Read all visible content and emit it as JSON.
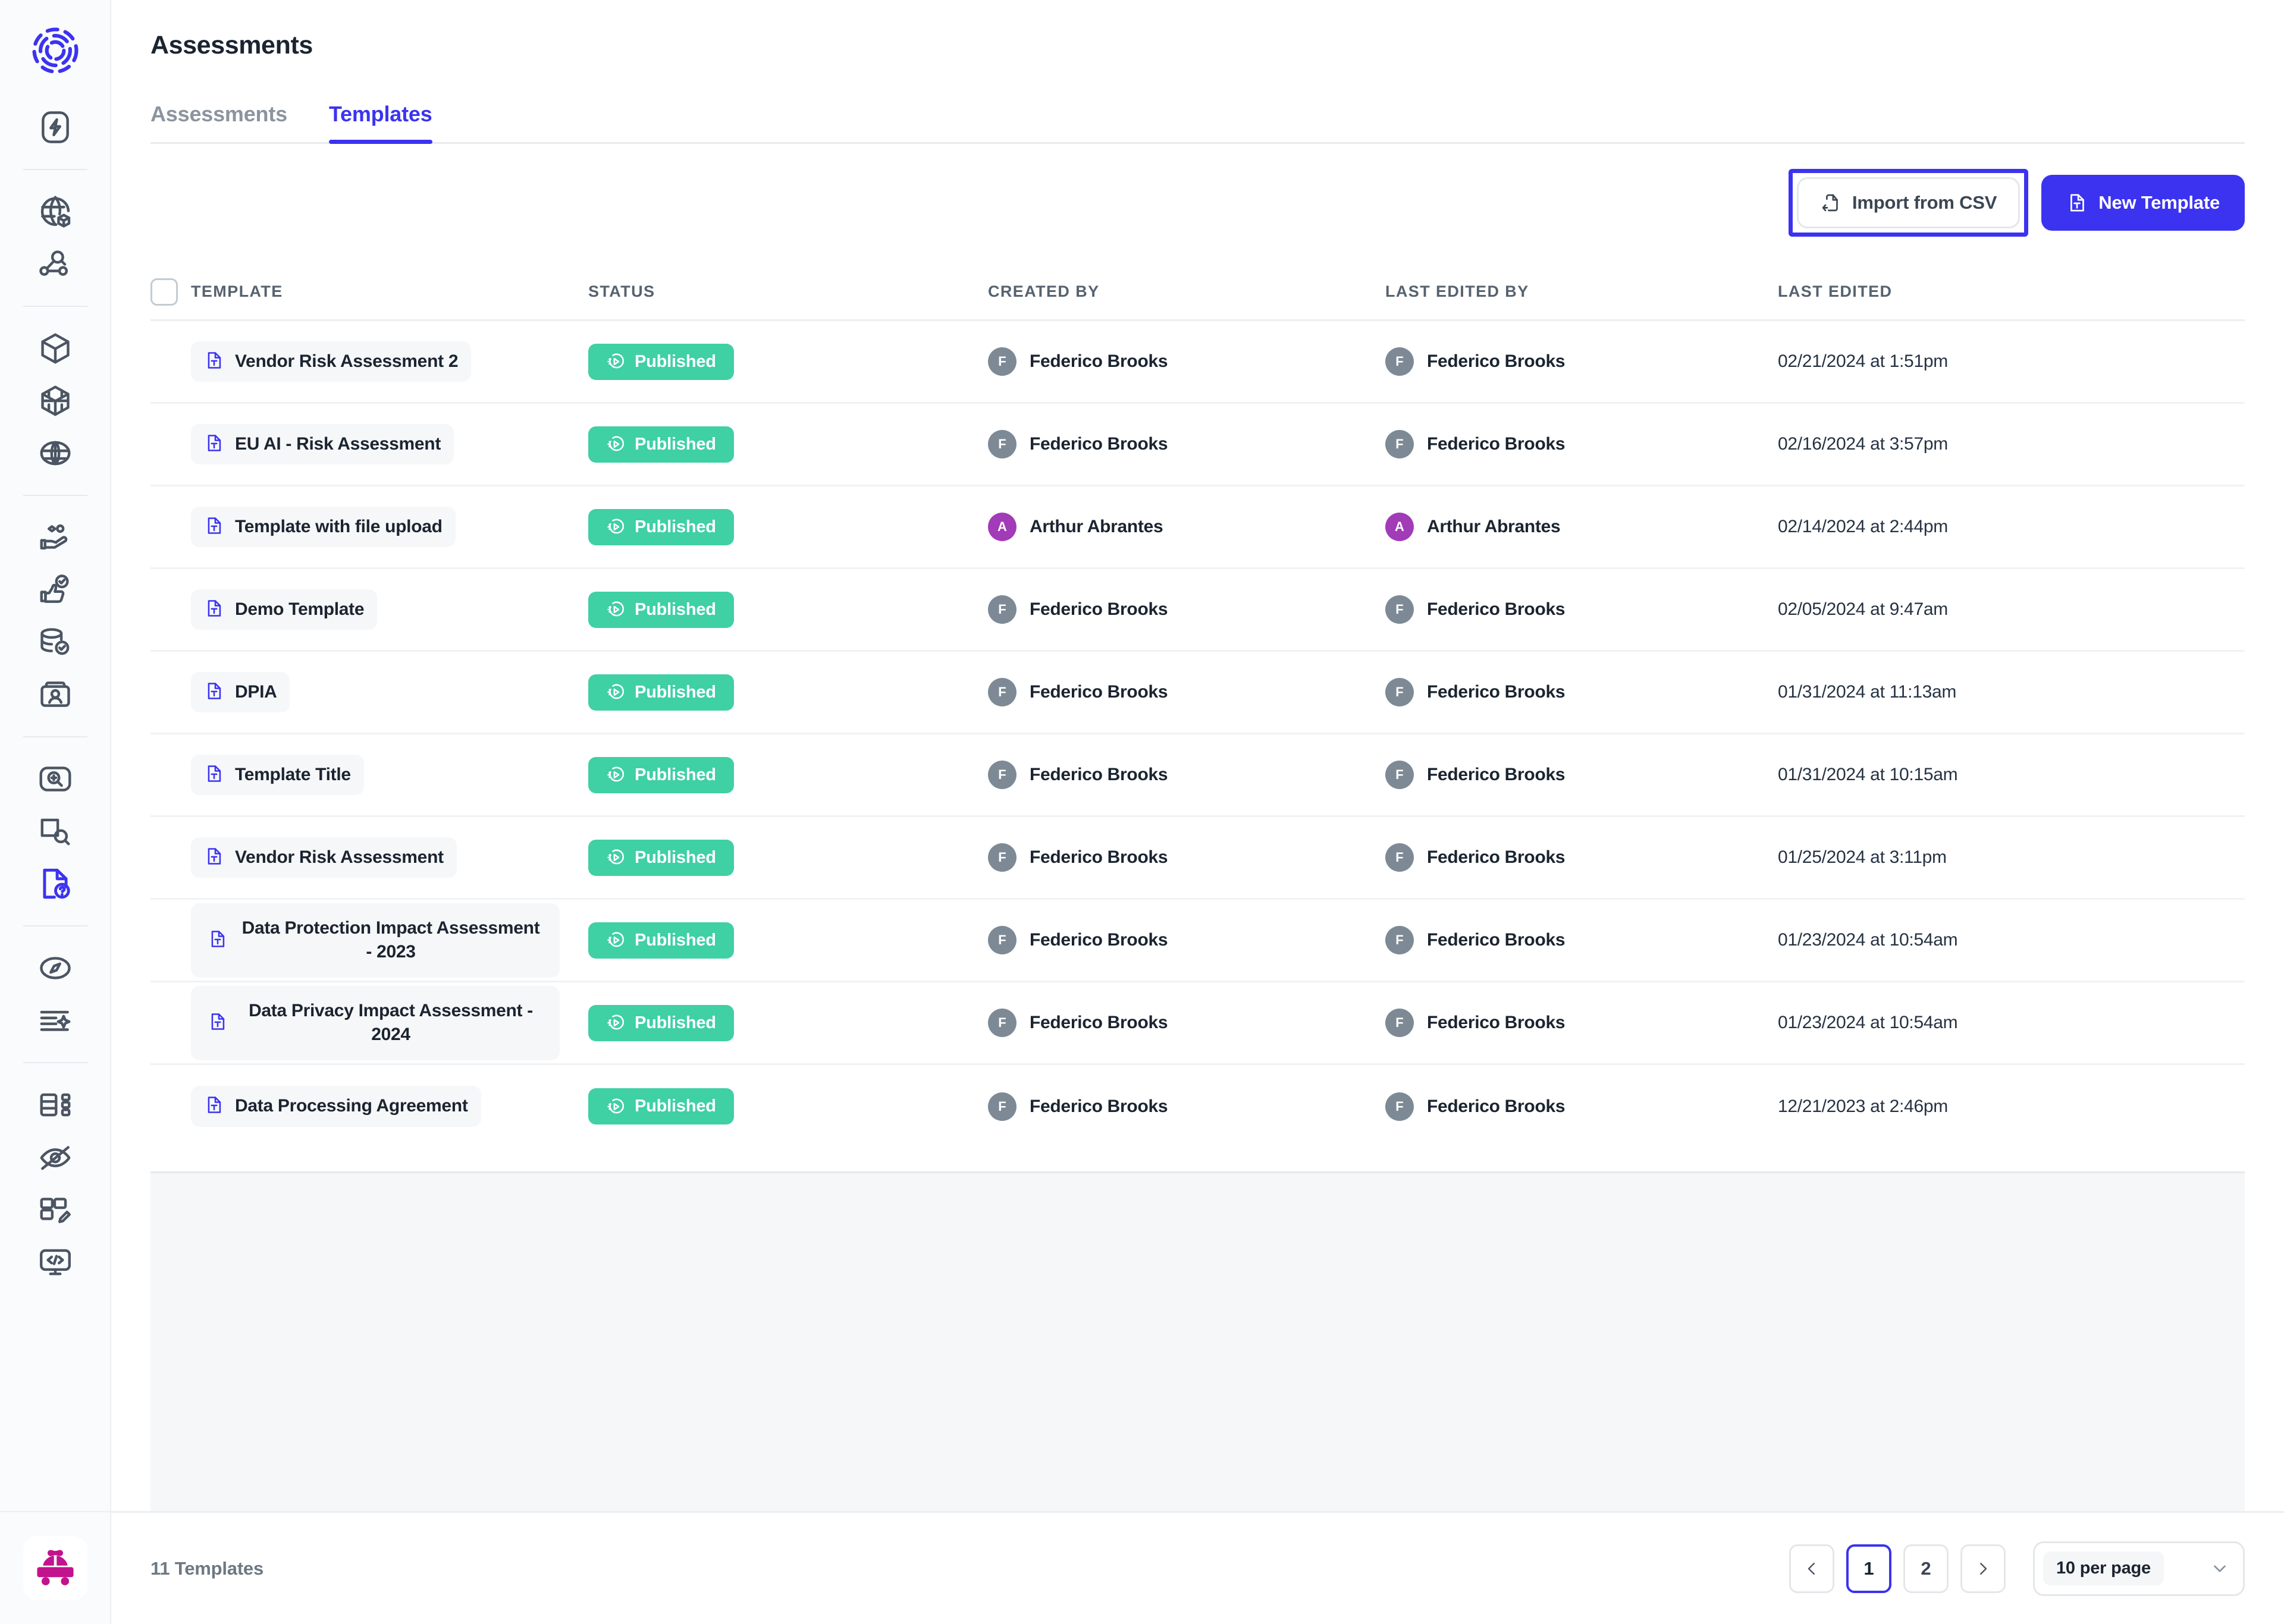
{
  "app": {
    "logo_icon": "fingerprint-circle-logo",
    "brand_icon": "pink-car-icon"
  },
  "sidebar": {
    "items": [
      {
        "icon": "lightning-bolt-icon",
        "name": "automation"
      },
      {
        "icon": "globe-box-icon",
        "name": "data-inventory"
      },
      {
        "icon": "network-search-icon",
        "name": "data-discovery"
      },
      {
        "icon": "cube-icon",
        "name": "assets"
      },
      {
        "icon": "cube-grid-icon",
        "name": "systems"
      },
      {
        "icon": "globe-sphere-icon",
        "name": "regions"
      },
      {
        "icon": "hand-coins-icon",
        "name": "vendors"
      },
      {
        "icon": "thumbs-up-check-icon",
        "name": "consent"
      },
      {
        "icon": "database-check-icon",
        "name": "data-governance"
      },
      {
        "icon": "id-card-icon",
        "name": "subject-requests"
      },
      {
        "icon": "search-zoom-icon",
        "name": "scans"
      },
      {
        "icon": "page-search-icon",
        "name": "reports"
      },
      {
        "icon": "document-question-icon",
        "name": "assessments"
      },
      {
        "icon": "compass-icon",
        "name": "navigator"
      },
      {
        "icon": "list-sparkle-icon",
        "name": "ai-insights"
      },
      {
        "icon": "table-tree-icon",
        "name": "schema"
      },
      {
        "icon": "eye-off-icon",
        "name": "privacy"
      },
      {
        "icon": "layout-edit-icon",
        "name": "customize"
      },
      {
        "icon": "code-screen-icon",
        "name": "developers"
      }
    ]
  },
  "header": {
    "title": "Assessments"
  },
  "tabs": [
    {
      "label": "Assessments",
      "active": false
    },
    {
      "label": "Templates",
      "active": true
    }
  ],
  "toolbar": {
    "import_label": "Import from CSV",
    "import_icon": "csv-import-icon",
    "new_template_label": "New Template",
    "new_template_icon": "document-text-icon",
    "import_focused": true
  },
  "table": {
    "columns": [
      "TEMPLATE",
      "STATUS",
      "CREATED BY",
      "LAST EDITED BY",
      "LAST EDITED"
    ],
    "select_all_checkbox": false,
    "rows": [
      {
        "template": "Vendor Risk Assessment 2",
        "status": "Published",
        "created_by": {
          "name": "Federico Brooks",
          "initial": "F",
          "color": "#7d8a96"
        },
        "last_edited_by": {
          "name": "Federico Brooks",
          "initial": "F",
          "color": "#7d8a96"
        },
        "last_edited": "02/21/2024 at 1:51pm"
      },
      {
        "template": "EU AI - Risk Assessment",
        "status": "Published",
        "created_by": {
          "name": "Federico Brooks",
          "initial": "F",
          "color": "#7d8a96"
        },
        "last_edited_by": {
          "name": "Federico Brooks",
          "initial": "F",
          "color": "#7d8a96"
        },
        "last_edited": "02/16/2024 at 3:57pm"
      },
      {
        "template": "Template with file upload",
        "status": "Published",
        "created_by": {
          "name": "Arthur Abrantes",
          "initial": "A",
          "color": "#a23bb8"
        },
        "last_edited_by": {
          "name": "Arthur Abrantes",
          "initial": "A",
          "color": "#a23bb8"
        },
        "last_edited": "02/14/2024 at 2:44pm"
      },
      {
        "template": "Demo Template",
        "status": "Published",
        "created_by": {
          "name": "Federico Brooks",
          "initial": "F",
          "color": "#7d8a96"
        },
        "last_edited_by": {
          "name": "Federico Brooks",
          "initial": "F",
          "color": "#7d8a96"
        },
        "last_edited": "02/05/2024 at 9:47am"
      },
      {
        "template": "DPIA",
        "status": "Published",
        "created_by": {
          "name": "Federico Brooks",
          "initial": "F",
          "color": "#7d8a96"
        },
        "last_edited_by": {
          "name": "Federico Brooks",
          "initial": "F",
          "color": "#7d8a96"
        },
        "last_edited": "01/31/2024 at 11:13am"
      },
      {
        "template": "Template Title",
        "status": "Published",
        "created_by": {
          "name": "Federico Brooks",
          "initial": "F",
          "color": "#7d8a96"
        },
        "last_edited_by": {
          "name": "Federico Brooks",
          "initial": "F",
          "color": "#7d8a96"
        },
        "last_edited": "01/31/2024 at 10:15am"
      },
      {
        "template": "Vendor Risk Assessment",
        "status": "Published",
        "created_by": {
          "name": "Federico Brooks",
          "initial": "F",
          "color": "#7d8a96"
        },
        "last_edited_by": {
          "name": "Federico Brooks",
          "initial": "F",
          "color": "#7d8a96"
        },
        "last_edited": "01/25/2024 at 3:11pm"
      },
      {
        "template": "Data Protection Impact Assessment - 2023",
        "status": "Published",
        "created_by": {
          "name": "Federico Brooks",
          "initial": "F",
          "color": "#7d8a96"
        },
        "last_edited_by": {
          "name": "Federico Brooks",
          "initial": "F",
          "color": "#7d8a96"
        },
        "last_edited": "01/23/2024 at 10:54am"
      },
      {
        "template": "Data Privacy Impact Assessment - 2024",
        "status": "Published",
        "created_by": {
          "name": "Federico Brooks",
          "initial": "F",
          "color": "#7d8a96"
        },
        "last_edited_by": {
          "name": "Federico Brooks",
          "initial": "F",
          "color": "#7d8a96"
        },
        "last_edited": "01/23/2024 at 10:54am"
      },
      {
        "template": "Data Processing Agreement",
        "status": "Published",
        "created_by": {
          "name": "Federico Brooks",
          "initial": "F",
          "color": "#7d8a96"
        },
        "last_edited_by": {
          "name": "Federico Brooks",
          "initial": "F",
          "color": "#7d8a96"
        },
        "last_edited": "12/21/2023 at 2:46pm"
      }
    ]
  },
  "footer": {
    "count_label": "11 Templates",
    "prev_icon": "chevron-left-icon",
    "next_icon": "chevron-right-icon",
    "pages": [
      "1",
      "2"
    ],
    "current_page": "1",
    "per_page_value": "10 per page",
    "per_page_chevron": "chevron-down-icon"
  },
  "colors": {
    "accent": "#3b33f0",
    "status_published": "#3fd0a4",
    "brand_pink": "#c2128d",
    "text_dark": "#1b2430",
    "text_muted": "#8b949e"
  }
}
